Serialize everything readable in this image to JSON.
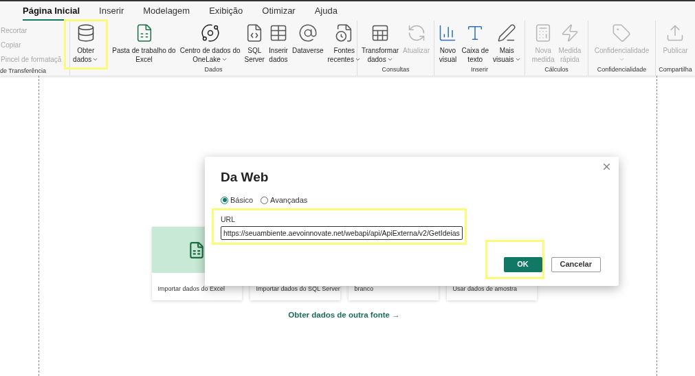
{
  "tabs": [
    {
      "label": "Página Inicial",
      "selected": true
    },
    {
      "label": "Inserir",
      "selected": false
    },
    {
      "label": "Modelagem",
      "selected": false
    },
    {
      "label": "Exibição",
      "selected": false
    },
    {
      "label": "Otimizar",
      "selected": false
    },
    {
      "label": "Ajuda",
      "selected": false
    }
  ],
  "clipboard": {
    "items": [
      {
        "label": "Recortar",
        "disabled": true
      },
      {
        "label": "Copiar",
        "disabled": true
      },
      {
        "label": "Pincel de formataçã",
        "disabled": true
      }
    ],
    "label": "de Transferência"
  },
  "ribbon_groups": [
    {
      "label": "Dados",
      "buttons": [
        {
          "lines": [
            "Obter",
            "dados"
          ],
          "dropdown": true,
          "disabled": false,
          "highlighted": true
        },
        {
          "lines": [
            "Pasta de trabalho do",
            "Excel"
          ],
          "dropdown": false,
          "disabled": false,
          "highlighted": false
        },
        {
          "lines": [
            "Centro de dados do",
            "OneLake"
          ],
          "dropdown": true,
          "disabled": false,
          "highlighted": false
        },
        {
          "lines": [
            "SQL",
            "Server"
          ],
          "dropdown": false,
          "disabled": false,
          "highlighted": false
        },
        {
          "lines": [
            "Inserir",
            "dados"
          ],
          "dropdown": false,
          "disabled": false,
          "highlighted": false
        },
        {
          "lines": [
            "Dataverse"
          ],
          "dropdown": false,
          "disabled": false,
          "highlighted": false
        },
        {
          "lines": [
            "Fontes",
            "recentes"
          ],
          "dropdown": true,
          "disabled": false,
          "highlighted": false
        }
      ]
    },
    {
      "label": "Consultas",
      "buttons": [
        {
          "lines": [
            "Transformar",
            "dados"
          ],
          "dropdown": true,
          "disabled": false,
          "highlighted": false
        },
        {
          "lines": [
            "Atualizar"
          ],
          "dropdown": false,
          "disabled": true,
          "highlighted": false
        }
      ]
    },
    {
      "label": "Inserir",
      "buttons": [
        {
          "lines": [
            "Novo",
            "visual"
          ],
          "dropdown": false,
          "disabled": false,
          "highlighted": false
        },
        {
          "lines": [
            "Caixa de",
            "texto"
          ],
          "dropdown": false,
          "disabled": false,
          "highlighted": false
        },
        {
          "lines": [
            "Mais",
            "visuais"
          ],
          "dropdown": true,
          "disabled": false,
          "highlighted": false
        }
      ]
    },
    {
      "label": "Cálculos",
      "buttons": [
        {
          "lines": [
            "Nova",
            "medida"
          ],
          "dropdown": false,
          "disabled": true,
          "highlighted": false
        },
        {
          "lines": [
            "Medida",
            "rápida"
          ],
          "dropdown": false,
          "disabled": true,
          "highlighted": false
        }
      ]
    },
    {
      "label": "Confidencialidade",
      "buttons": [
        {
          "lines": [
            "Confidencialidade"
          ],
          "dropdown": true,
          "disabled": true,
          "highlighted": false
        }
      ]
    },
    {
      "label": "Compartilha",
      "buttons": [
        {
          "lines": [
            "Publicar"
          ],
          "dropdown": false,
          "disabled": true,
          "highlighted": false
        }
      ]
    }
  ],
  "canvas": {
    "cards": [
      {
        "label": "Importar dados do Excel",
        "kind": "excel"
      },
      {
        "label": "Importar dados do SQL Server",
        "kind": "plain"
      },
      {
        "label": "branco",
        "kind": "plain"
      },
      {
        "label": "Usar dados de amostra",
        "kind": "plain"
      }
    ],
    "link": "Obter dados de outra fonte →"
  },
  "dialog": {
    "title": "Da Web",
    "options": [
      {
        "label": "Básico",
        "selected": true
      },
      {
        "label": "Avançadas",
        "selected": false
      }
    ],
    "url_label": "URL",
    "url_value": "https://seuambiente.aevoinnovate.net/webapi/api/ApiExterna/v2/GetIdeias",
    "url_highlighted": true,
    "buttons": [
      {
        "label": "OK",
        "kind": "primary",
        "highlighted": true
      },
      {
        "label": "Cancelar",
        "kind": "secondary",
        "highlighted": false
      }
    ]
  }
}
